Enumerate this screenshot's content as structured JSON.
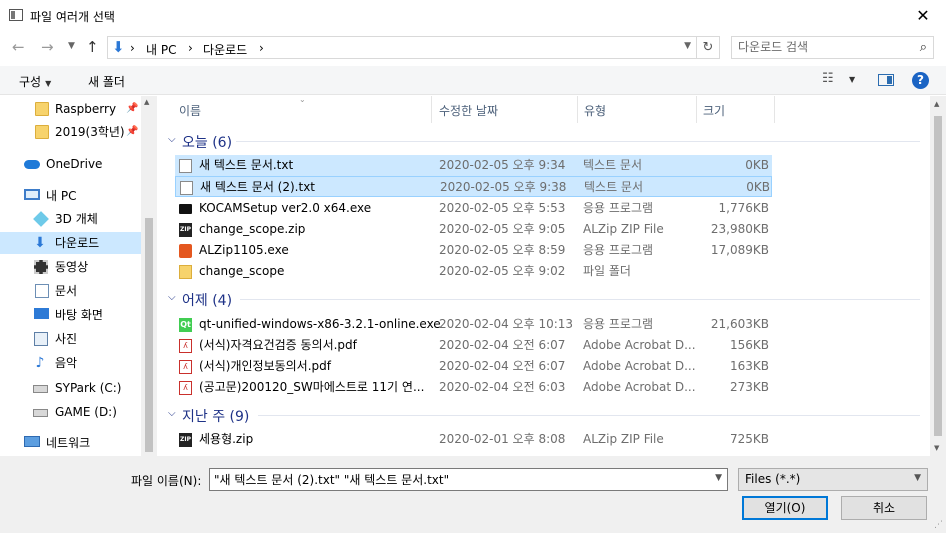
{
  "window": {
    "title": "파일 여러개 선택",
    "close_glyph": "✕"
  },
  "address": {
    "segments": [
      "내 PC",
      "다운로드"
    ],
    "separator": "›",
    "search_placeholder": "다운로드 검색"
  },
  "toolbar": {
    "organize_label": "구성",
    "new_folder_label": "새 폴더",
    "help_glyph": "?"
  },
  "nav": {
    "items": [
      {
        "label": "Raspberry",
        "icon": "folder-icon",
        "pinned": true
      },
      {
        "label": "2019(3학년)",
        "icon": "folder-icon",
        "pinned": true
      },
      {
        "label": "OneDrive",
        "icon": "onedrive-icon"
      },
      {
        "label": "내 PC",
        "icon": "pc-icon"
      },
      {
        "label": "3D 개체",
        "icon": "3d-objects-icon"
      },
      {
        "label": "다운로드",
        "icon": "download-icon",
        "selected": true
      },
      {
        "label": "동영상",
        "icon": "video-icon"
      },
      {
        "label": "문서",
        "icon": "document-icon"
      },
      {
        "label": "바탕 화면",
        "icon": "desktop-icon"
      },
      {
        "label": "사진",
        "icon": "pictures-icon"
      },
      {
        "label": "음악",
        "icon": "music-icon"
      },
      {
        "label": "SYPark (C:)",
        "icon": "drive-icon"
      },
      {
        "label": "GAME (D:)",
        "icon": "drive-icon"
      },
      {
        "label": "네트워크",
        "icon": "network-icon"
      }
    ]
  },
  "columns": {
    "name": "이름",
    "date": "수정한 날짜",
    "type": "유형",
    "size": "크기"
  },
  "groups": [
    {
      "label": "오늘 (6)",
      "files": [
        {
          "name": "새 텍스트 문서.txt",
          "date": "2020-02-05 오후 9:34",
          "type": "텍스트 문서",
          "size": "0KB",
          "icon": "text-file-icon",
          "selected": true
        },
        {
          "name": "새 텍스트 문서 (2).txt",
          "date": "2020-02-05 오후 9:38",
          "type": "텍스트 문서",
          "size": "0KB",
          "icon": "text-file-icon",
          "selected": true
        },
        {
          "name": "KOCAMSetup ver2.0 x64.exe",
          "date": "2020-02-05 오후 5:53",
          "type": "응용 프로그램",
          "size": "1,776KB",
          "icon": "app-exe-icon"
        },
        {
          "name": "change_scope.zip",
          "date": "2020-02-05 오후 9:05",
          "type": "ALZip ZIP File",
          "size": "23,980KB",
          "icon": "zip-file-icon"
        },
        {
          "name": "ALZip1105.exe",
          "date": "2020-02-05 오후 8:59",
          "type": "응용 프로그램",
          "size": "17,089KB",
          "icon": "alzip-icon"
        },
        {
          "name": "change_scope",
          "date": "2020-02-05 오후 9:02",
          "type": "파일 폴더",
          "size": "",
          "icon": "folder-icon"
        }
      ]
    },
    {
      "label": "어제 (4)",
      "files": [
        {
          "name": "qt-unified-windows-x86-3.2.1-online.exe",
          "date": "2020-02-04 오후 10:13",
          "type": "응용 프로그램",
          "size": "21,603KB",
          "icon": "qt-icon"
        },
        {
          "name": "(서식)자격요건검증 동의서.pdf",
          "date": "2020-02-04 오전 6:07",
          "type": "Adobe Acrobat D...",
          "size": "156KB",
          "icon": "pdf-icon"
        },
        {
          "name": "(서식)개인정보동의서.pdf",
          "date": "2020-02-04 오전 6:07",
          "type": "Adobe Acrobat D...",
          "size": "163KB",
          "icon": "pdf-icon"
        },
        {
          "name": "(공고문)200120_SW마에스트로 11기 연...",
          "date": "2020-02-04 오전 6:03",
          "type": "Adobe Acrobat D...",
          "size": "273KB",
          "icon": "pdf-icon"
        }
      ]
    },
    {
      "label": "지난 주 (9)",
      "files": [
        {
          "name": "세용형.zip",
          "date": "2020-02-01 오후 8:08",
          "type": "ALZip ZIP File",
          "size": "725KB",
          "icon": "zip-file-icon"
        }
      ]
    }
  ],
  "bottom": {
    "filename_label": "파일 이름(N):",
    "filename_value": "\"새 텍스트 문서 (2).txt\" \"새 텍스트 문서.txt\"",
    "filter_value": "Files (*.*)",
    "open_label": "열기(O)",
    "cancel_label": "취소"
  }
}
